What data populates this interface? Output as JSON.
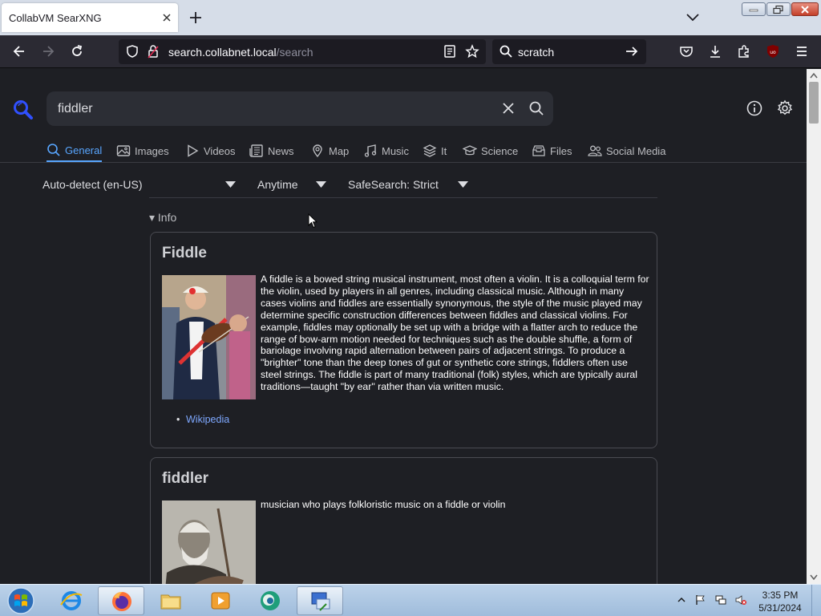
{
  "browser": {
    "tab_title": "CollabVM SearXNG",
    "url_host": "search.collabnet.local",
    "url_path": "/search",
    "search_box": "scratch"
  },
  "search": {
    "query": "fiddler"
  },
  "categories": [
    {
      "label": "General",
      "icon": "search-icon",
      "active": true
    },
    {
      "label": "Images",
      "icon": "image-icon"
    },
    {
      "label": "Videos",
      "icon": "play-icon"
    },
    {
      "label": "News",
      "icon": "newspaper-icon"
    },
    {
      "label": "Map",
      "icon": "map-pin-icon"
    },
    {
      "label": "Music",
      "icon": "music-icon"
    },
    {
      "label": "It",
      "icon": "layers-icon"
    },
    {
      "label": "Science",
      "icon": "school-icon"
    },
    {
      "label": "Files",
      "icon": "file-tray-icon"
    },
    {
      "label": "Social Media",
      "icon": "people-icon"
    }
  ],
  "filters": {
    "language": "Auto-detect (en-US)",
    "time": "Anytime",
    "safesearch": "SafeSearch: Strict"
  },
  "info_toggle": "▾ Info",
  "infoboxes": [
    {
      "title": "Fiddle",
      "text": "A fiddle is a bowed string musical instrument, most often a violin. It is a colloquial term for the violin, used by players in all genres, including classical music. Although in many cases violins and fiddles are essentially synonymous, the style of the music played may determine specific construction differences between fiddles and classical violins. For example, fiddles may optionally be set up with a bridge with a flatter arch to reduce the range of bow-arm motion needed for techniques such as the double shuffle, a form of bariolage involving rapid alternation between pairs of adjacent strings. To produce a \"brighter\" tone than the deep tones of gut or synthetic core strings, fiddlers often use steel strings. The fiddle is part of many traditional (folk) styles, which are typically aural traditions—taught \"by ear\" rather than via written music.",
      "link": "Wikipedia"
    },
    {
      "title": "fiddler",
      "text": "musician who plays folkloristic music on a fiddle or violin"
    }
  ],
  "clock": {
    "time": "3:35 PM",
    "date": "5/31/2024"
  },
  "colors": {
    "accent": "#58a6ff",
    "link": "#7ea8ff",
    "page_bg": "#1e1f24"
  }
}
